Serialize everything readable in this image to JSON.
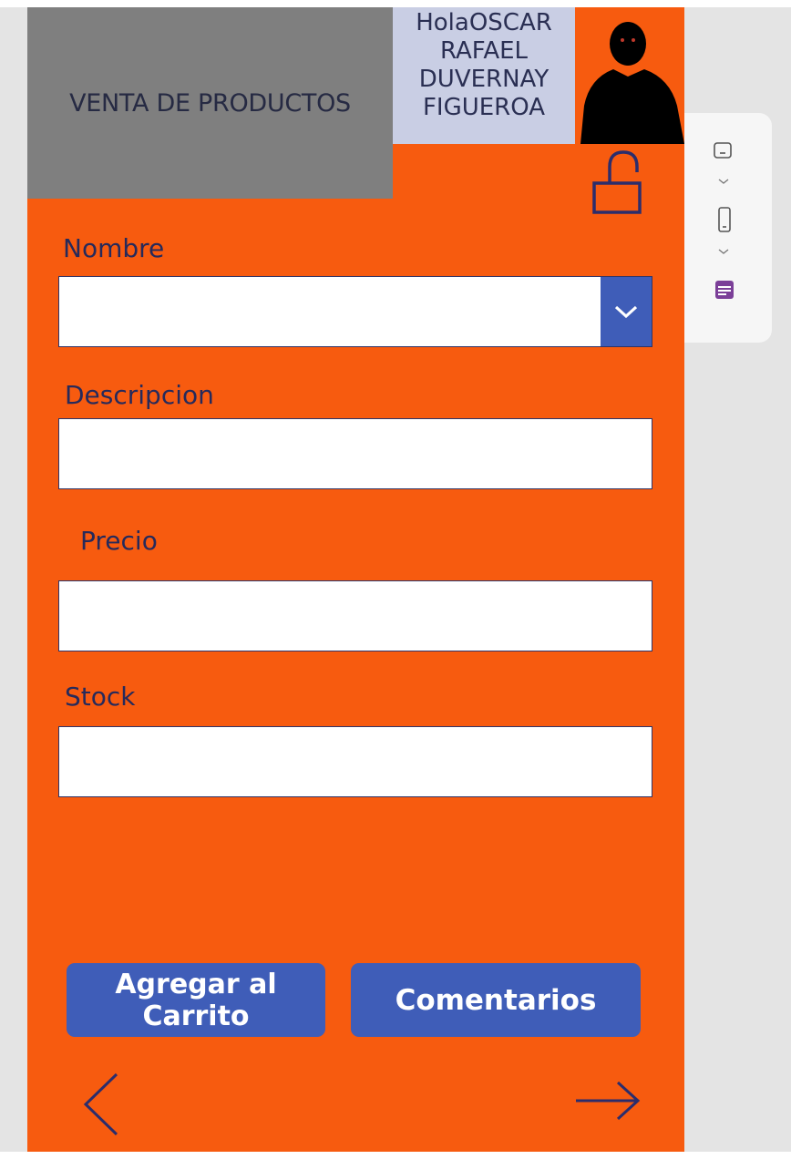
{
  "header": {
    "title": "VENTA DE PRODUCTOS",
    "greeting_lines": [
      "HolaOSCAR",
      "RAFAEL",
      "DUVERNAY",
      "FIGUEROA"
    ]
  },
  "form": {
    "nombre": {
      "label": "Nombre",
      "value": ""
    },
    "descripcion": {
      "label": "Descripcion",
      "value": ""
    },
    "precio": {
      "label": "Precio",
      "value": ""
    },
    "stock": {
      "label": "Stock",
      "value": ""
    }
  },
  "buttons": {
    "add_to_cart_lines": [
      "Agregar al",
      "Carrito"
    ],
    "comments": "Comentarios"
  },
  "icons": {
    "lock": "unlocked-padlock-icon",
    "back": "chevron-left-icon",
    "next": "arrow-right-icon",
    "dropdown": "chevron-down-icon"
  },
  "colors": {
    "background": "#f75b0f",
    "header": "#7f7f7f",
    "greeting": "#c9cee4",
    "button": "#3f5db8",
    "text": "#262a5b"
  }
}
